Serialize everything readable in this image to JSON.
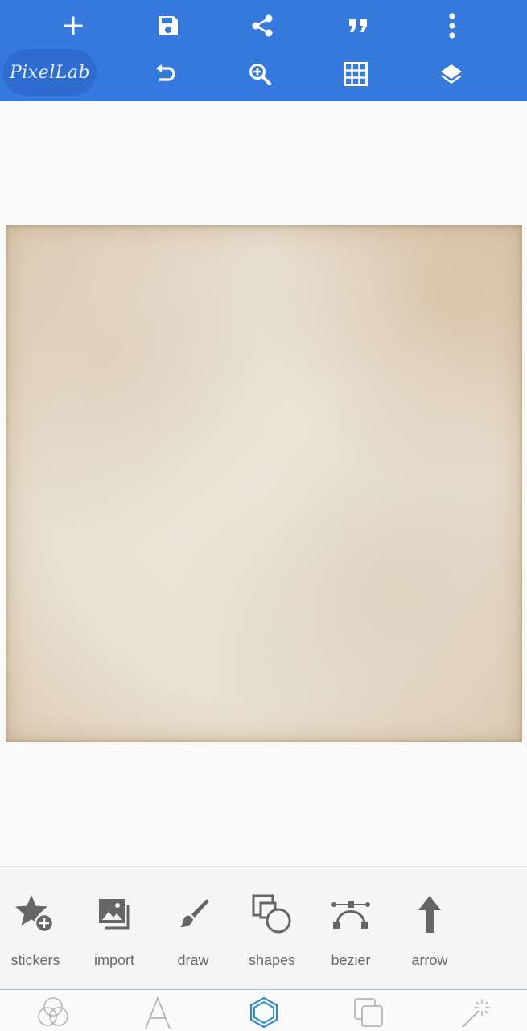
{
  "app": {
    "logo_text": "PixelLab"
  },
  "toolbar": {
    "row1": [
      "add-icon",
      "save-icon",
      "share-icon",
      "quote-icon",
      "more-vert-icon"
    ],
    "row2": [
      "undo-icon",
      "zoom-in-icon",
      "grid-icon",
      "layers-icon"
    ],
    "accent_color": "#3579dc"
  },
  "tools": [
    {
      "label": "stickers",
      "icon": "sticker-add-icon"
    },
    {
      "label": "import",
      "icon": "image-import-icon"
    },
    {
      "label": "draw",
      "icon": "brush-icon"
    },
    {
      "label": "shapes",
      "icon": "shapes-icon"
    },
    {
      "label": "bezier",
      "icon": "bezier-icon"
    },
    {
      "label": "arrow",
      "icon": "arrow-up-icon"
    }
  ],
  "bottom_nav": [
    {
      "icon": "color-circles-icon",
      "active": false
    },
    {
      "icon": "text-icon",
      "active": false
    },
    {
      "icon": "hexagon-icon",
      "active": true
    },
    {
      "icon": "layers-squares-icon",
      "active": false
    },
    {
      "icon": "magic-wand-icon",
      "active": false
    }
  ],
  "canvas": {
    "background": "aged-paper-texture"
  }
}
